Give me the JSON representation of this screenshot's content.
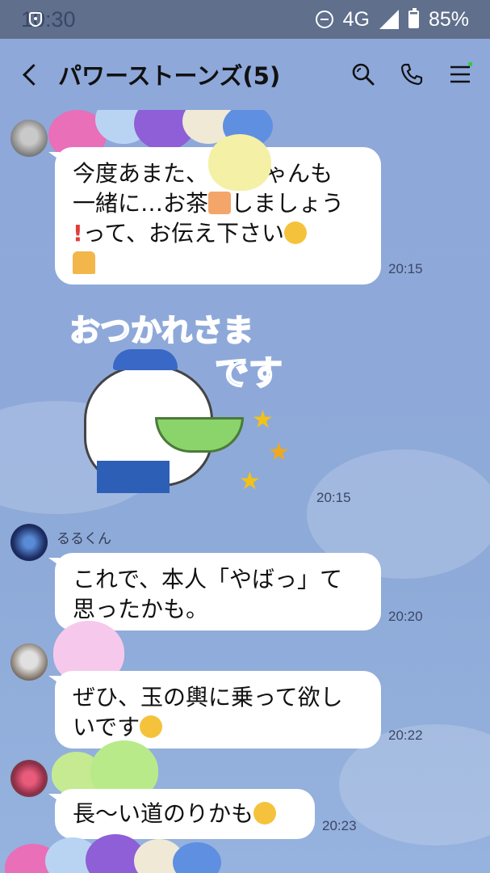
{
  "status_bar": {
    "time": "10:30",
    "network": "4G",
    "battery": "85%"
  },
  "header": {
    "title": "パワーストーンズ(5)"
  },
  "messages": [
    {
      "sender": "",
      "lines": [
        "今度あまた、　　ちゃんも",
        "一緒に…お茶",
        "しましょう",
        "って、お伝え下さい"
      ],
      "time": "20:15"
    },
    {
      "sticker_text_line1": "おつかれさま",
      "sticker_text_line2": "です",
      "time": "20:15"
    },
    {
      "sender": "るるくん",
      "lines": [
        "これで、本人「やばっ」て",
        "思ったかも。"
      ],
      "time": "20:20"
    },
    {
      "sender": "",
      "lines": [
        "ぜひ、玉の輿に乗って欲し",
        "いです"
      ],
      "time": "20:22"
    },
    {
      "sender": "",
      "lines": [
        "長〜い道のりかも"
      ],
      "time": "20:23"
    }
  ],
  "colors": {
    "background": "#8ea8da",
    "statusbar": "#5f6f8c",
    "bubble": "#ffffff"
  },
  "icons": [
    "back-icon",
    "search-icon",
    "phone-icon",
    "menu-icon"
  ]
}
